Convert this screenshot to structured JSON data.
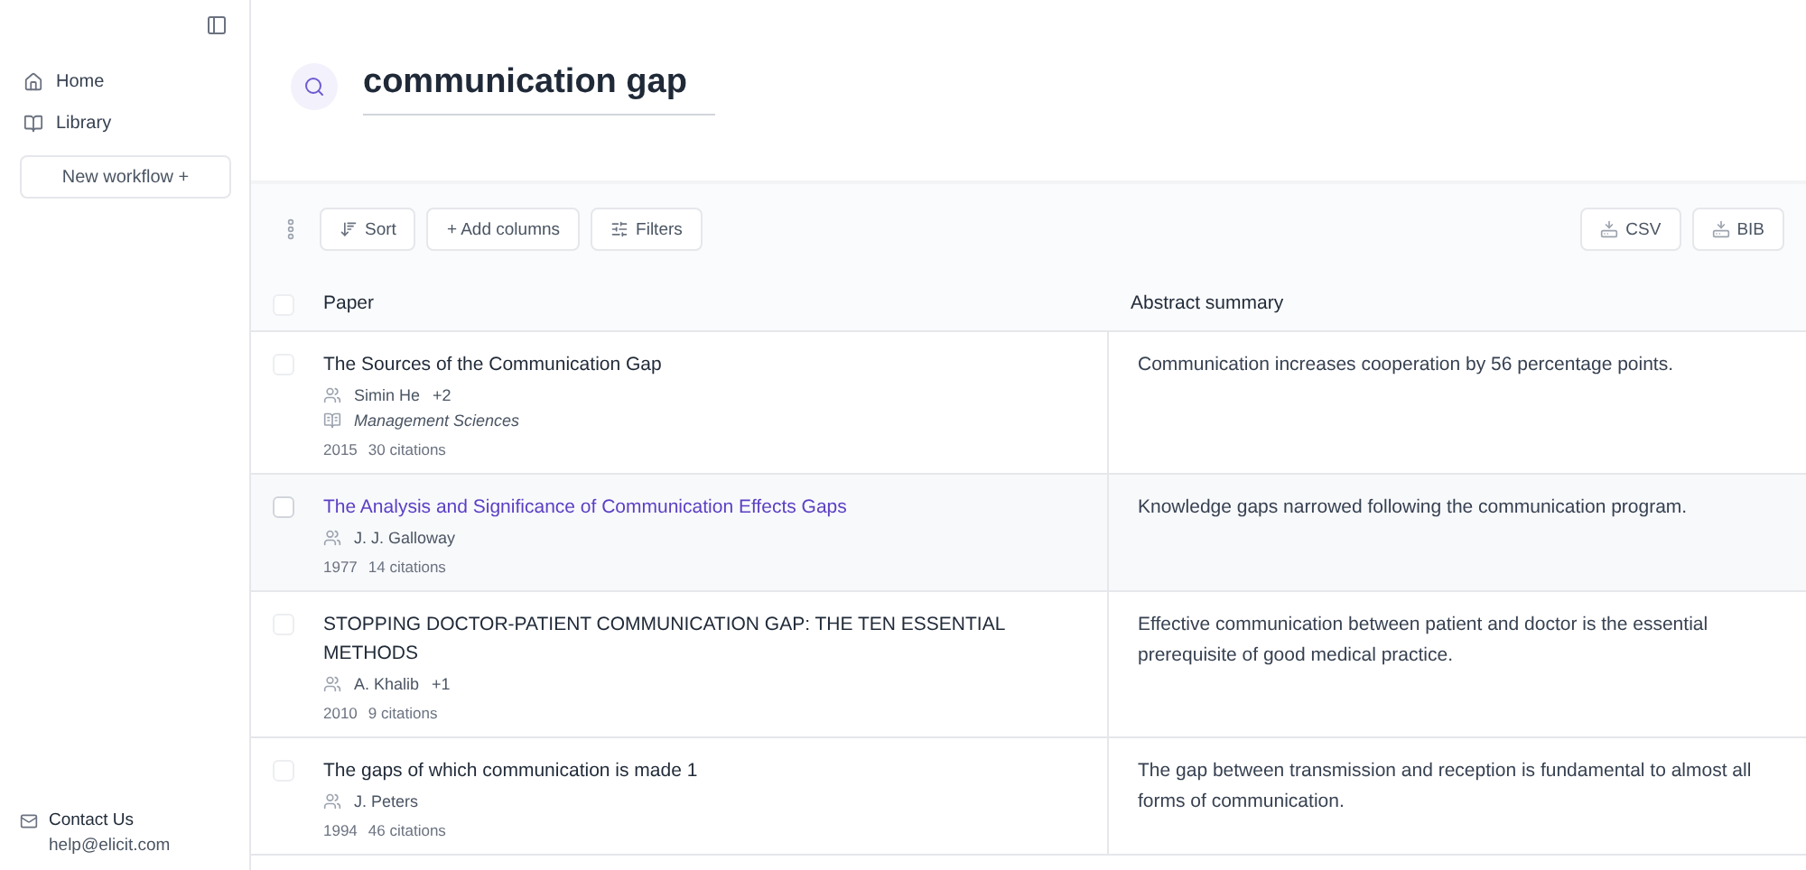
{
  "sidebar": {
    "items": [
      {
        "label": "Home",
        "kind": "home"
      },
      {
        "label": "Library",
        "kind": "library"
      }
    ],
    "new_workflow": "New workflow +",
    "contact": {
      "label": "Contact Us",
      "email": "help@elicit.com"
    }
  },
  "search": {
    "query": "communication gap"
  },
  "toolbar": {
    "left": [
      {
        "label": "Sort",
        "kind": "sort"
      },
      {
        "label": "+ Add columns",
        "kind": "add"
      },
      {
        "label": "Filters",
        "kind": "filters"
      }
    ],
    "right": [
      {
        "label": "CSV"
      },
      {
        "label": "BIB"
      }
    ]
  },
  "table": {
    "select_all_checked": false,
    "columns": [
      "Paper",
      "Abstract summary"
    ],
    "rows": [
      {
        "title": "The Sources of the Communication Gap",
        "author": "Simin He",
        "more_authors": "+2",
        "journal": "Management Sciences",
        "year": "2015",
        "citations": "30 citations",
        "summary": "Communication increases cooperation by 56 percentage points.",
        "selected": false
      },
      {
        "title": "The Analysis and Significance of Communication Effects Gaps",
        "author": "J. J. Galloway",
        "year": "1977",
        "citations": "14 citations",
        "summary": "Knowledge gaps narrowed following the communication program.",
        "selected": true
      },
      {
        "title": "STOPPING DOCTOR-PATIENT COMMUNICATION GAP: THE TEN ESSENTIAL METHODS",
        "author": "A. Khalib",
        "more_authors": "+1",
        "year": "2010",
        "citations": "9 citations",
        "summary": "Effective communication between patient and doctor is the essential prerequisite of good medical practice.",
        "selected": false
      },
      {
        "title": "The gaps of which communication is made 1",
        "author": "J. Peters",
        "year": "1994",
        "citations": "46 citations",
        "summary": "The gap between transmission and reception is fundamental to almost all forms of communication.",
        "selected": false
      }
    ]
  }
}
